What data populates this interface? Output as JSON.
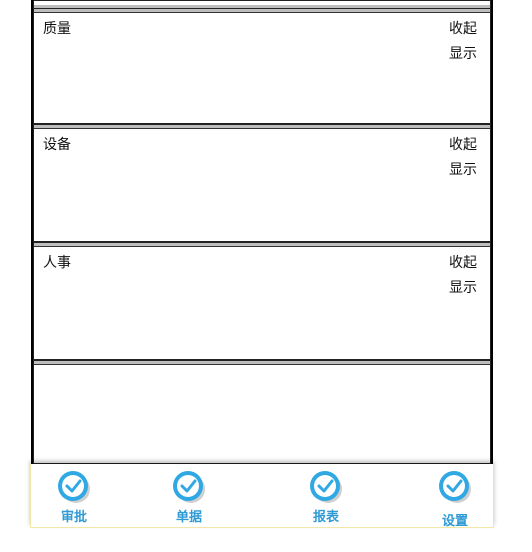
{
  "panels": [
    {
      "title": "",
      "collapse_label": "",
      "show_label": ""
    },
    {
      "title": "质量",
      "collapse_label": "收起",
      "show_label": "显示"
    },
    {
      "title": "设备",
      "collapse_label": "收起",
      "show_label": "显示"
    },
    {
      "title": "人事",
      "collapse_label": "收起",
      "show_label": "显示"
    }
  ],
  "tabs": [
    {
      "label": "审批",
      "icon": "check-circle-icon"
    },
    {
      "label": "单据",
      "icon": "check-circle-icon"
    },
    {
      "label": "报表",
      "icon": "check-circle-icon"
    },
    {
      "label": "设置",
      "icon": "check-circle-icon"
    }
  ],
  "colors": {
    "tab_icon": "#2fa8e3",
    "tab_label": "#2f9ad4",
    "tabbar_border": "#f0e7a8"
  }
}
